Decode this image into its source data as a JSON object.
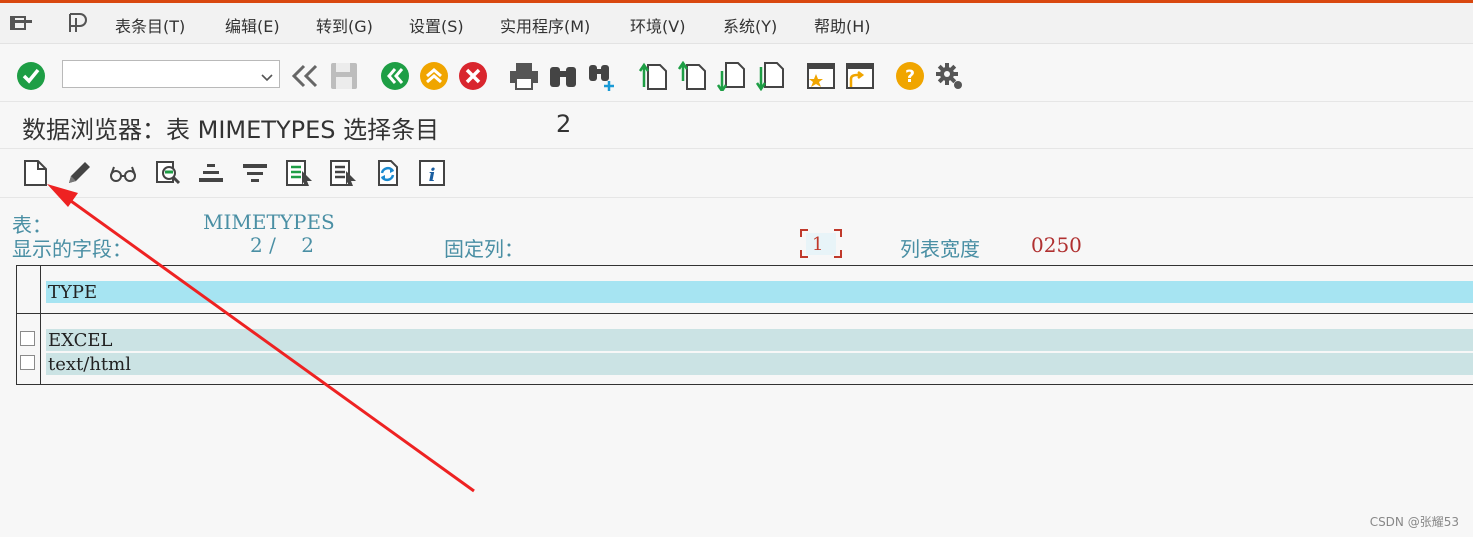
{
  "menu": {
    "items": [
      "表条目(T)",
      "编辑(E)",
      "转到(G)",
      "设置(S)",
      "实用程序(M)",
      "环境(V)",
      "系统(Y)",
      "帮助(H)"
    ]
  },
  "toolbar": {
    "command_value": "",
    "icons": [
      "enter-check-icon",
      "back-icon",
      "exit-icon",
      "cancel-icon",
      "print-icon",
      "find-icon",
      "find-next-icon",
      "first-page-icon",
      "prev-page-icon",
      "next-page-icon",
      "last-page-icon",
      "new-session-icon",
      "shortcut-icon",
      "help-icon",
      "settings-gear-icon"
    ]
  },
  "title": {
    "text": "数据浏览器：表 MIMETYPES 选择条目",
    "count": "2"
  },
  "info": {
    "table_label": "表：",
    "table_value": "MIMETYPES",
    "fields_label": "显示的字段：",
    "fields_value": "2 /    2",
    "fixed_cols_label": "固定列：",
    "fixed_cols_value": "1",
    "list_width_label": "列表宽度",
    "list_width_value": "0250"
  },
  "grid": {
    "column_header": "TYPE",
    "rows": [
      "EXCEL",
      "text/html"
    ]
  },
  "watermark": "CSDN @张耀53",
  "colors": {
    "accent_line": "#d9480f",
    "header_row": "#a6e4f2",
    "data_row": "#cbe3e4",
    "annotation_arrow": "#ee2222",
    "info_text": "#4a8fa4"
  }
}
